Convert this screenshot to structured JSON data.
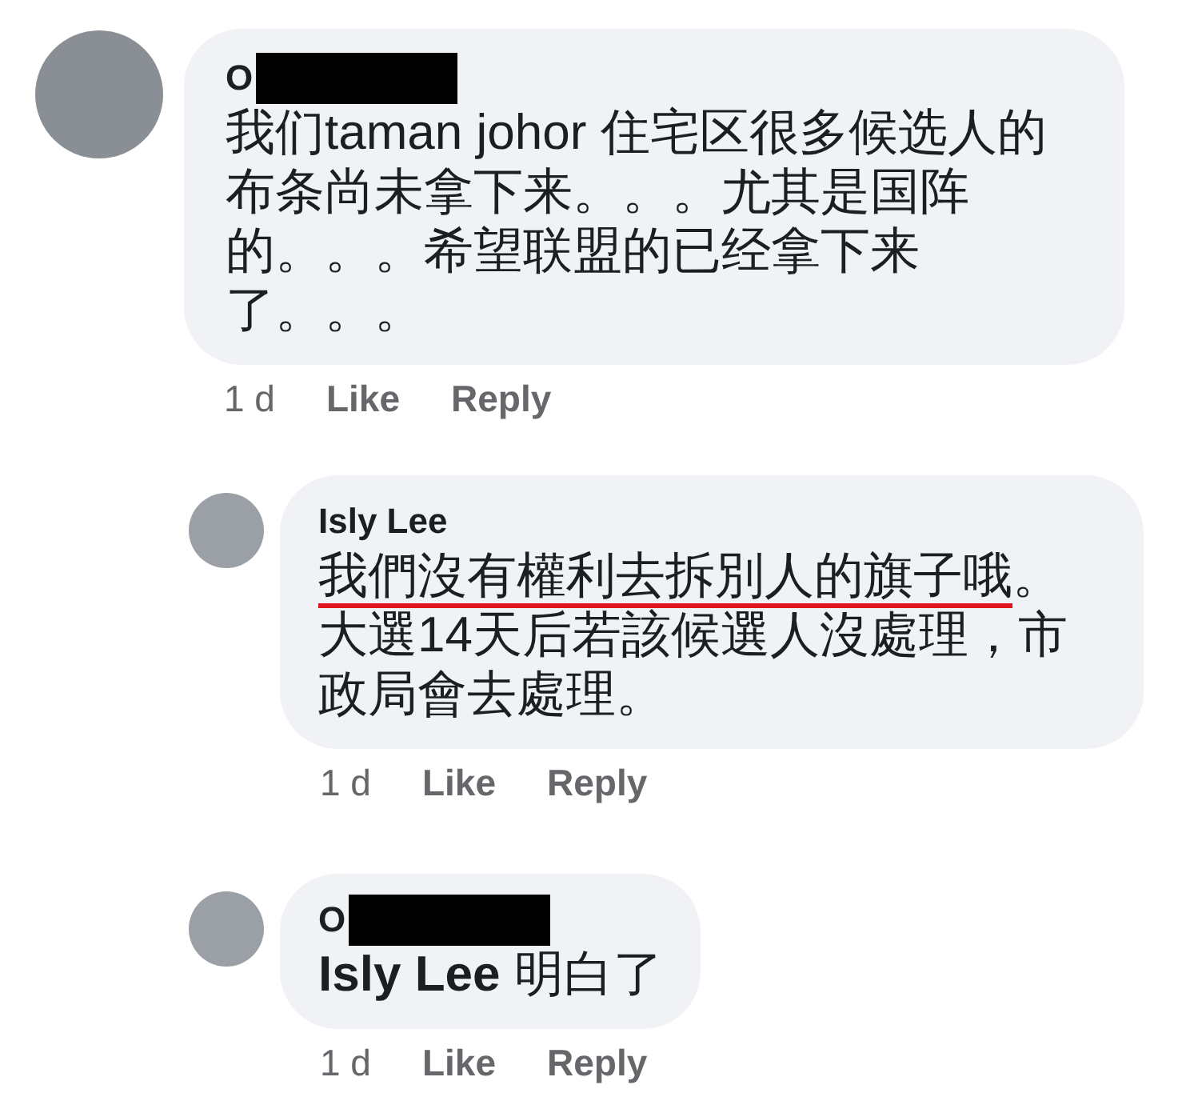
{
  "comments": [
    {
      "author": "O",
      "author_redacted": true,
      "lines": [
        [
          {
            "text": "我们taman johor 住宅区很多候选人的",
            "underlined": false
          }
        ],
        [
          {
            "text": "布条尚未拿下来。。。尤其是国阵",
            "underlined": false
          }
        ],
        [
          {
            "text": "的。。。希望联盟的已经拿下来",
            "underlined": false
          }
        ],
        [
          {
            "text": "了。。。",
            "underlined": false
          }
        ]
      ],
      "time": "1 d",
      "actions": [
        "Like",
        "Reply"
      ],
      "children": [
        {
          "author": "Isly Lee",
          "author_redacted": false,
          "lines": [
            [
              {
                "text": "我們沒有權利去拆別人的旗子哦",
                "underlined": true
              },
              {
                "text": "。",
                "underlined": false
              }
            ],
            [
              {
                "text": "大選14天后若該候選人沒處理，市",
                "underlined": false
              }
            ],
            [
              {
                "text": "政局會去處理。",
                "underlined": false
              }
            ]
          ],
          "time": "1 d",
          "actions": [
            "Like",
            "Reply"
          ]
        },
        {
          "author": "O",
          "author_redacted": true,
          "lines": [
            [
              {
                "text": "**Isly Lee** 明白了",
                "underlined": false
              }
            ]
          ],
          "time": "1 d",
          "actions": [
            "Like",
            "Reply"
          ]
        }
      ]
    }
  ]
}
